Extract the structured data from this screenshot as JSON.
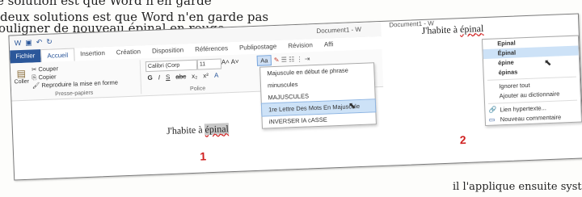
{
  "article": {
    "line1": "e solution est que Word n'en garde",
    "line2": "deux solutions est que Word n'en garde pas",
    "line3": "ouligner de nouveau épinal en rouge.",
    "bottom": "il l'applique ensuite systématiquem"
  },
  "word": {
    "doc_title": "Document1 - W",
    "tabs": [
      "Fichier",
      "Accueil",
      "Insertion",
      "Création",
      "Disposition",
      "Références",
      "Publipostage",
      "Révision",
      "Affi"
    ],
    "clipboard": {
      "paste": "Coller",
      "cut": "Couper",
      "copy": "Copier",
      "format_painter": "Reproduire la mise en forme",
      "group_label": "Presse-papiers"
    },
    "font": {
      "family": "Calibri (Corp",
      "size": "11",
      "group_label": "Police"
    },
    "change_case_button": "Aa",
    "change_case_menu": [
      "Majuscule en début de phrase",
      "minuscules",
      "MAJUSCULES",
      "1re Lettre Des Mots En Majuscule",
      "iNVERSER lA cASSE"
    ],
    "highlighted_item_index": 3,
    "doc_text_prefix": "J'habite à ",
    "doc_text_word": "épinal"
  },
  "right": {
    "doc_title": "Document1 - W",
    "text_prefix": "J'habite à ",
    "text_word": "épinal",
    "suggestions": [
      "Epinal",
      "Épinal",
      "épine",
      "épinas"
    ],
    "highlighted_index": 1,
    "actions": [
      "Ignorer tout",
      "Ajouter au dictionnaire",
      "Lien hypertexte...",
      "Nouveau commentaire"
    ]
  },
  "labels": {
    "one": "1",
    "two": "2"
  },
  "colors": {
    "accent": "#2b579a",
    "marker": "#d02020",
    "highlight": "#cde2f7"
  }
}
